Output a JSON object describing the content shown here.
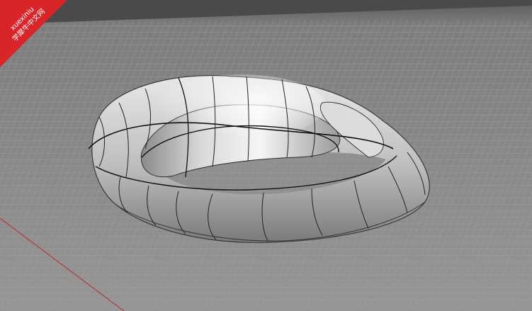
{
  "watermark": {
    "site": "xuexiniu",
    "name_cn": "学犀牛中文网",
    "color": "#d9252a"
  },
  "viewport": {
    "background": "#8d8d8d",
    "grid_color": "#a5a5a5",
    "axis_x_color": "#b23a3a",
    "object": "torus-surface"
  }
}
